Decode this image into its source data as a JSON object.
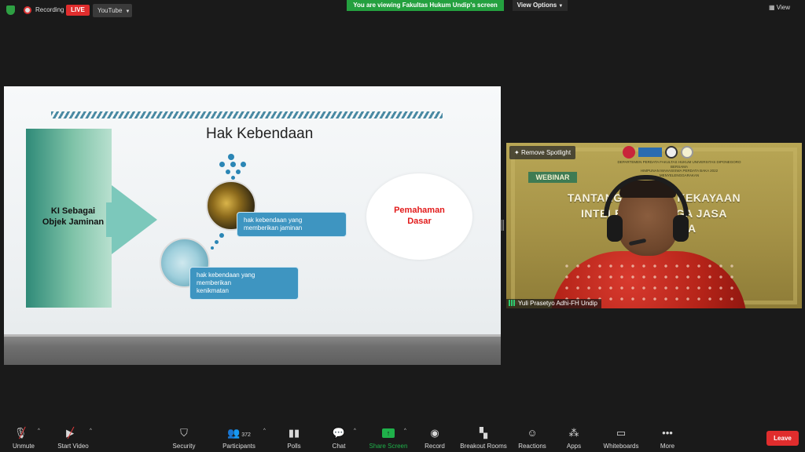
{
  "topbar": {
    "recording_label": "Recording",
    "live_label": "LIVE",
    "stream_target": "YouTube",
    "viewing_banner": "You are viewing Fakultas Hukum Undip's screen",
    "view_options_label": "View Options",
    "view_label": "View"
  },
  "slide": {
    "title": "Hak Kebendaan",
    "left_label_line1": "KI Sebagai",
    "left_label_line2": "Objek Jaminan",
    "callout1_line1": "hak kebendaan yang",
    "callout1_line2": "memberikan jaminan",
    "callout2_line1": "hak kebendaan yang",
    "callout2_line2": "memberikan",
    "callout2_line3": "kenikmatan",
    "oval_line1": "Pemahaman",
    "oval_line2": "Dasar"
  },
  "video": {
    "remove_spotlight_label": "Remove Spotlight",
    "webinar_label": "WEBINAR",
    "small_line1": "DEPARTEMEN PERDATA FAKULTAS HUKUM UNIVERSITAS DIPONEGORO",
    "small_line2": "BERSAMA",
    "small_line3": "HIMPUNAN MAHASISWA PERDATA BAKA 2022",
    "small_line4": "MENYELENGGARAKAN",
    "headline1": "TANTANGAN P        IAN KEKAYAAN",
    "headline2": "INTELEKTU       MBAGA JASA",
    "headline3": "KEU/         DONESIA",
    "participant_name": "Yuli Prasetyo Adhi-FH Undip"
  },
  "toolbar": {
    "unmute": "Unmute",
    "start_video": "Start Video",
    "security": "Security",
    "participants": "Participants",
    "participants_count": "372",
    "polls": "Polls",
    "chat": "Chat",
    "share_screen": "Share Screen",
    "record": "Record",
    "breakout_rooms": "Breakout Rooms",
    "reactions": "Reactions",
    "apps": "Apps",
    "whiteboards": "Whiteboards",
    "more": "More",
    "leave": "Leave"
  },
  "colors": {
    "live_red": "#e02d2d",
    "viewing_green": "#24a03f",
    "callout_blue": "#3e95c1",
    "slide_accent_teal": "#2f8a78",
    "oval_text_red": "#e21b1b"
  }
}
